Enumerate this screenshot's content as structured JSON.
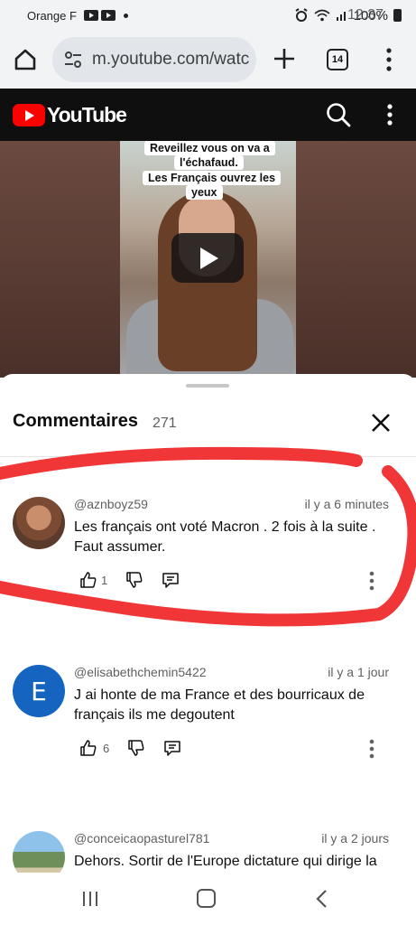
{
  "status_bar": {
    "carrier": "Orange F",
    "time": "12:37",
    "battery": "100%"
  },
  "browser": {
    "url": "m.youtube.com/watc",
    "tab_count": "14"
  },
  "youtube": {
    "logo_text": "YouTube"
  },
  "video": {
    "caption_lines": [
      "Reveillez vous on va a",
      "l'échafaud.",
      "Les Français ouvrez les",
      "yeux"
    ]
  },
  "comments_panel": {
    "title": "Commentaires",
    "count": "271",
    "comments": [
      {
        "handle": "@aznboyz59",
        "time": "il y a 6 minutes",
        "text": "Les français ont voté  Macron . 2 fois à la suite . Faut assumer.",
        "likes": "1",
        "avatar_letter": ""
      },
      {
        "handle": "@elisabethchemin5422",
        "time": "il y a 1 jour",
        "text": "J ai honte de ma France et des bourricaux de français ils me degoutent",
        "likes": "6",
        "avatar_letter": "E"
      },
      {
        "handle": "@conceicaopasturel781",
        "time": "il y a 2 jours",
        "text": "Dehors. Sortir de l'Europe dictature qui dirige la",
        "likes": "",
        "avatar_letter": ""
      }
    ]
  },
  "colors": {
    "youtube_red": "#ff0000",
    "annotation_red": "#ef2b2b",
    "avatar_blue": "#1565c0"
  }
}
